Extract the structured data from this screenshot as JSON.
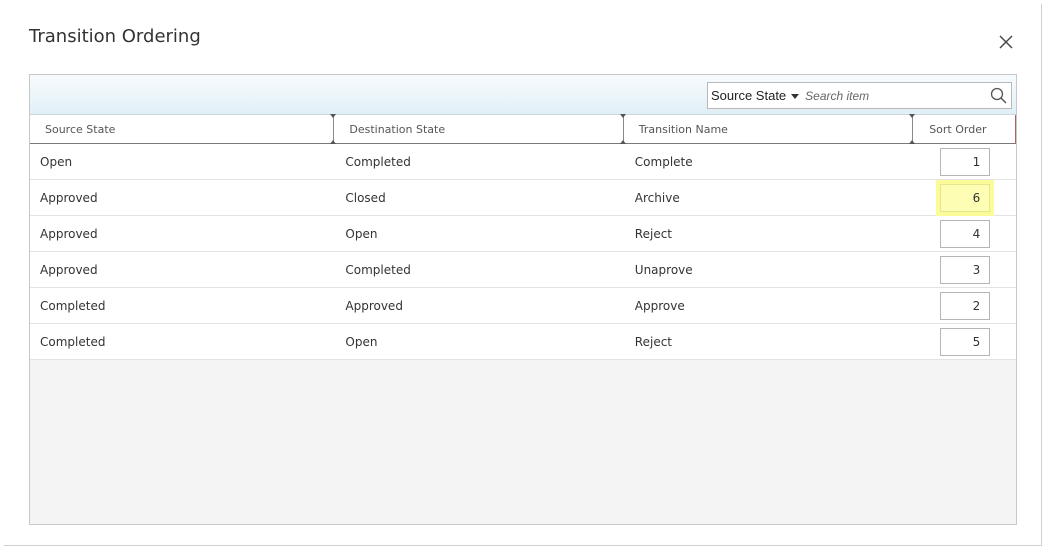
{
  "dialog": {
    "title": "Transition Ordering"
  },
  "toolbar": {
    "search_field": "Source State",
    "search_placeholder": "Search item",
    "search_value": ""
  },
  "columns": {
    "source": "Source State",
    "destination": "Destination State",
    "transition": "Transition Name",
    "sort": "Sort Order"
  },
  "rows": [
    {
      "source": "Open",
      "destination": "Completed",
      "transition": "Complete",
      "sort": "1"
    },
    {
      "source": "Approved",
      "destination": "Closed",
      "transition": "Archive",
      "sort": "6"
    },
    {
      "source": "Approved",
      "destination": "Open",
      "transition": "Reject",
      "sort": "4"
    },
    {
      "source": "Approved",
      "destination": "Completed",
      "transition": "Unaprove",
      "sort": "3"
    },
    {
      "source": "Completed",
      "destination": "Approved",
      "transition": "Approve",
      "sort": "2"
    },
    {
      "source": "Completed",
      "destination": "Open",
      "transition": "Reject",
      "sort": "5"
    }
  ],
  "highlighted_row": 1,
  "colors": {
    "highlight": "#fbfb9a",
    "toolbar_bottom": "#e1eff6"
  },
  "icons": {
    "close": "close-icon",
    "search": "search-icon",
    "dropdown": "chevron-down-icon"
  }
}
